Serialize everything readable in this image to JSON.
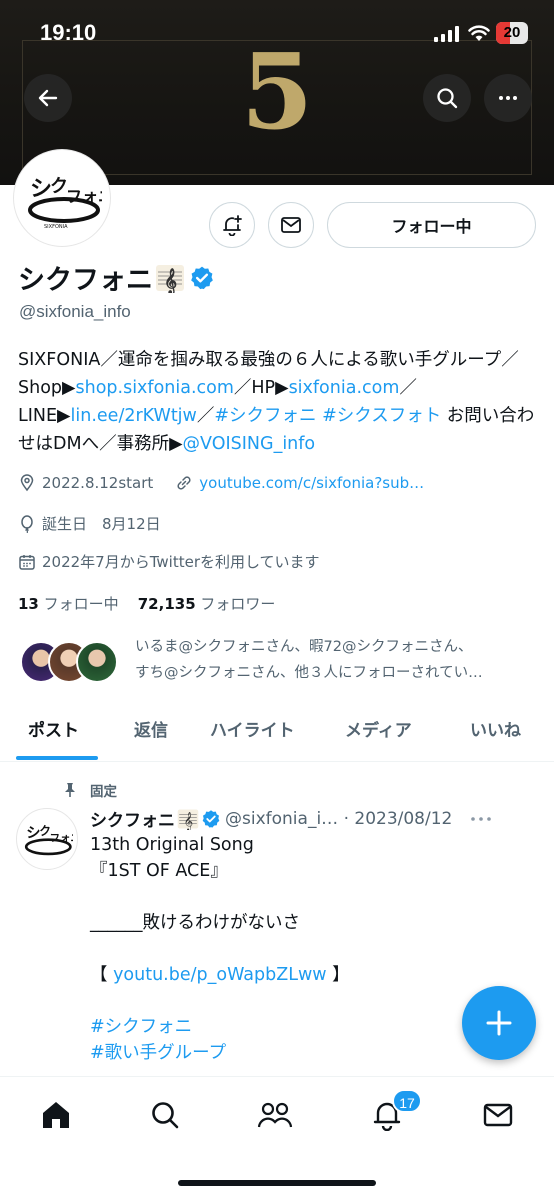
{
  "status_bar": {
    "time": "19:10",
    "battery": "20"
  },
  "banner": {
    "number": "5"
  },
  "profile": {
    "name": "シクフォニ",
    "handle": "@sixfonia_info",
    "follow_button": "フォロー中",
    "bio": {
      "t1": "SIXFONIA／運命を掴み取る最強の６人による歌い手グループ／ Shop▶",
      "l1": "shop.sixfonia.com",
      "t2": "／HP▶",
      "l2": "sixfonia.com",
      "t3": "／ LINE▶",
      "l3": "lin.ee/2rKWtjw",
      "t4": "／",
      "l4": "#シクフォニ #シクスフォト",
      "t5": " お問い合わせはDMへ／事務所▶",
      "l5": "@VOISING_info"
    },
    "location": "2022.8.12start",
    "website": "youtube.com/c/sixfonia?sub…",
    "birthday": "誕生日　8月12日",
    "joined": "2022年7月からTwitterを利用しています",
    "following_count": "13",
    "following_label": "フォロー中",
    "followers_count": "72,135",
    "followers_label": "フォロワー",
    "known_followers_line1": "いるま@シクフォニさん、暇72@シクフォニさん、",
    "known_followers_line2": "すち@シクフォニさん、他３人にフォローされてい…"
  },
  "tabs": [
    "ポスト",
    "返信",
    "ハイライト",
    "メディア",
    "いいね"
  ],
  "post": {
    "pinned_label": "固定",
    "author": "シクフォニ",
    "meta": "@sixfonia_i… · 2023/08/12",
    "line1": "13th Original Song",
    "line2": "『1ST OF ACE』",
    "line3": "______敗けるわけがないさ",
    "link_open": "【 ",
    "link": "youtu.be/p_oWapbZLww",
    "link_close": " 】",
    "tag1": "#シクフォニ",
    "tag2": "#歌い手グループ"
  },
  "nav": {
    "notification_count": "17"
  },
  "colors": {
    "accent": "#1d9bf0",
    "banner_gold": "#bfa86b",
    "text_secondary": "#536471"
  },
  "icons": [
    "back-arrow-icon",
    "search-icon",
    "more-icon",
    "bell-plus-icon",
    "mail-icon",
    "verified-badge-icon",
    "location-icon",
    "link-icon",
    "balloon-icon",
    "calendar-icon",
    "pin-icon",
    "plus-icon",
    "home-icon",
    "people-icon",
    "bell-icon"
  ]
}
